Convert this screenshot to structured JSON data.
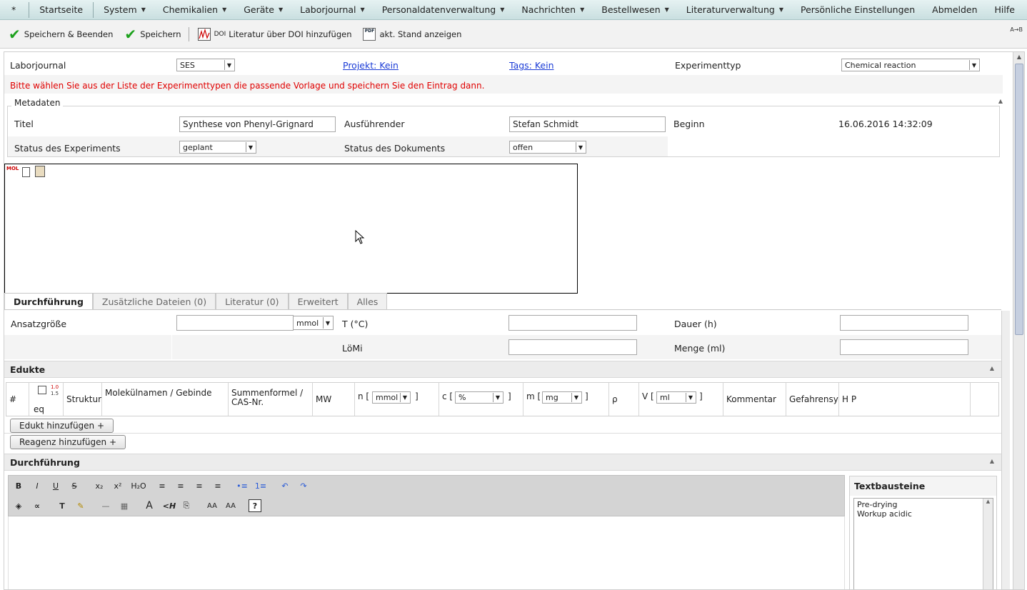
{
  "menu": {
    "star": "*",
    "items": [
      {
        "label": "Startseite",
        "dropdown": false
      },
      {
        "label": "System",
        "dropdown": true
      },
      {
        "label": "Chemikalien",
        "dropdown": true
      },
      {
        "label": "Geräte",
        "dropdown": true
      },
      {
        "label": "Laborjournal",
        "dropdown": true
      },
      {
        "label": "Personaldatenverwaltung",
        "dropdown": true
      },
      {
        "label": "Nachrichten",
        "dropdown": true
      },
      {
        "label": "Bestellwesen",
        "dropdown": true
      },
      {
        "label": "Literaturverwaltung",
        "dropdown": true
      },
      {
        "label": "Persönliche Einstellungen",
        "dropdown": false
      },
      {
        "label": "Abmelden",
        "dropdown": false
      },
      {
        "label": "Hilfe",
        "dropdown": false
      }
    ]
  },
  "toolbar": {
    "save_close": "Speichern & Beenden",
    "save": "Speichern",
    "doi_prefix": "DOI",
    "add_doi": "Literatur über DOI hinzufügen",
    "pdf_icon_text": "PDF",
    "show_state": "akt. Stand anzeigen",
    "ab_label": "A→B"
  },
  "header": {
    "journal_label": "Laborjournal",
    "journal_value": "SES",
    "project_link": "Projekt: Kein",
    "tags_link": "Tags: Kein",
    "exp_type_label": "Experimenttyp",
    "exp_type_value": "Chemical reaction",
    "warning": "Bitte wählen Sie aus der Liste der Experimenttypen die passende Vorlage und speichern Sie den Eintrag dann."
  },
  "metadata": {
    "legend": "Metadaten",
    "title_label": "Titel",
    "title_value": "Synthese von Phenyl-Grignard",
    "performer_label": "Ausführender",
    "performer_value": "Stefan Schmidt",
    "start_label": "Beginn",
    "start_value": "16.06.2016 14:32:09",
    "exp_status_label": "Status des Experiments",
    "exp_status_value": "geplant",
    "doc_status_label": "Status des Dokuments",
    "doc_status_value": "offen"
  },
  "canvas": {
    "mol_icon_text": "MOL"
  },
  "tabs": [
    "Durchführung",
    "Zusätzliche Dateien (0)",
    "Literatur (0)",
    "Erweitert",
    "Alles"
  ],
  "conditions": {
    "batch_label": "Ansatzgröße",
    "batch_unit": "mmol",
    "temp_label": "T (°C)",
    "duration_label": "Dauer (h)",
    "solvent_label": "LöMi",
    "amount_label": "Menge (ml)"
  },
  "educts": {
    "title": "Edukte",
    "eq_icon_top": "1.0",
    "eq_icon_bottom": "1.5",
    "columns": {
      "hash": "#",
      "eq": "eq",
      "structure": "Struktur",
      "names": "Molekülnamen / Gebinde",
      "formula": "Summenformel / CAS-Nr.",
      "mw": "MW",
      "n_label": "n [",
      "n_unit": "mmol",
      "c_label": "c [",
      "c_unit": "%",
      "m_label": "m [",
      "m_unit": "mg",
      "rho": "ρ",
      "v_label": "V [",
      "v_unit": "ml",
      "bracket_close": "]",
      "comment": "Kommentar",
      "hazard": "Gefahrensymbole",
      "hp": "H P"
    },
    "add_educt": "Edukt hinzufügen +",
    "add_reagent": "Reagenz hinzufügen +"
  },
  "procedure": {
    "title": "Durchführung",
    "snippets_title": "Textbausteine",
    "snippets": [
      "Pre-drying",
      "Workup acidic"
    ]
  },
  "editor": {
    "row1": [
      "B",
      "I",
      "U",
      "S",
      "x₂",
      "x²",
      "H₂O",
      "≡",
      "≡",
      "≡",
      "≡",
      "•≡",
      "1≡",
      "↶",
      "↷"
    ],
    "row2": [
      "◈",
      "∝",
      "T",
      "✎",
      "—",
      "▦",
      "A",
      "<H",
      "⎘",
      "AA",
      "AA",
      "?"
    ]
  }
}
